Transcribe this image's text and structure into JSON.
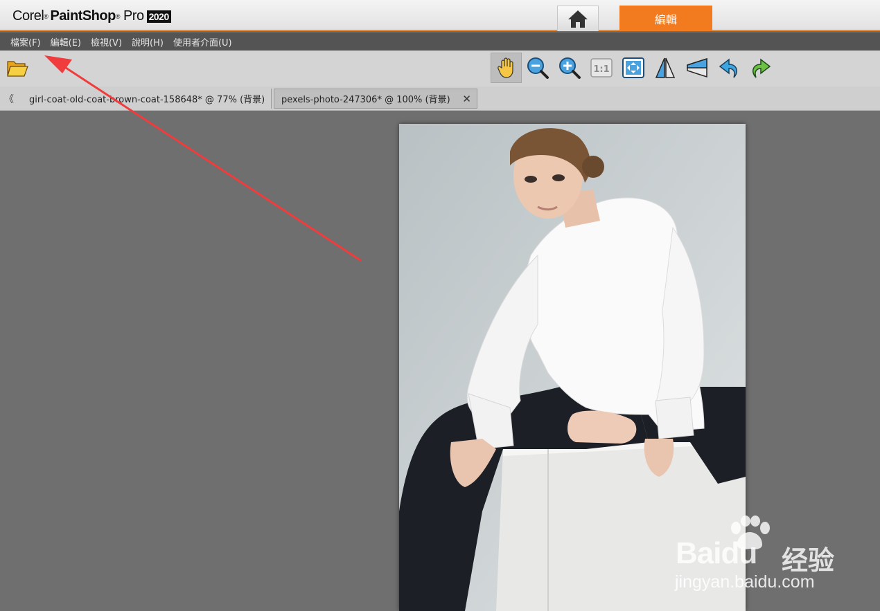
{
  "app": {
    "logo": {
      "brand": "Corel",
      "name": "PaintShop",
      "suffix": "Pro",
      "year": "2020"
    },
    "mode_tabs": {
      "home_icon": "home-icon",
      "edit_label": "編輯"
    }
  },
  "menu": {
    "file": "檔案(F)",
    "edit": "編輯(E)",
    "view": "檢視(V)",
    "help": "說明(H)",
    "ui": "使用者介面(U)"
  },
  "toolbar": {
    "tools": [
      "open-folder-icon",
      "pan-hand-icon",
      "zoom-out-icon",
      "zoom-in-icon",
      "actual-size-icon",
      "fit-to-window-icon",
      "flip-icon",
      "perspective-icon",
      "undo-icon",
      "redo-icon"
    ],
    "actual_size_label": "1:1",
    "active_tool": "pan-hand-icon"
  },
  "document_tabs": [
    {
      "label": "girl-coat-old-coat-brown-coat-158648* @  77% (背景)",
      "active": false
    },
    {
      "label": "pexels-photo-247306* @ 100% (背景)",
      "active": true
    }
  ],
  "scroll_left_glyph": "《",
  "close_glyph": "✕",
  "colors": {
    "accent_orange": "#f27a1f",
    "menubar": "#545454",
    "workspace": "#6f6f6f",
    "annotation_arrow": "#f03c3c"
  },
  "watermark": {
    "brand": "Bai",
    "brand_du": "du",
    "brand_cn": "经验",
    "url": "jingyan.baidu.com"
  }
}
